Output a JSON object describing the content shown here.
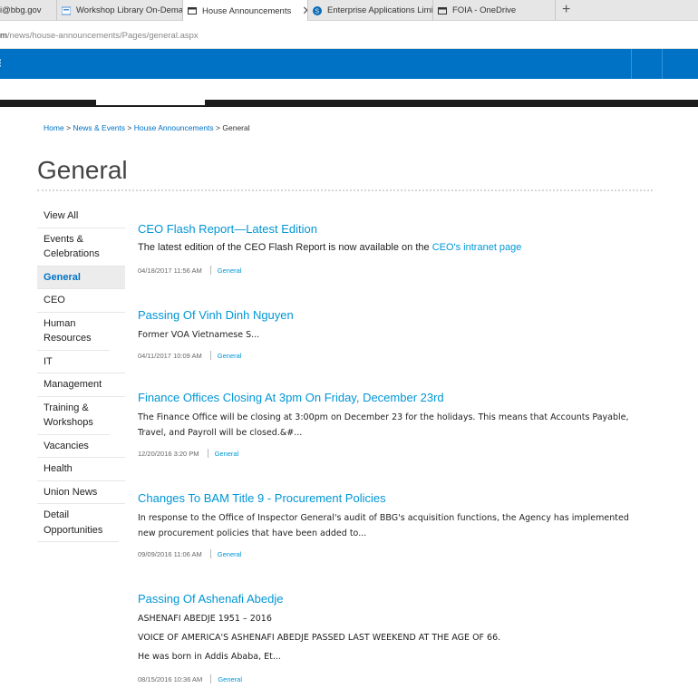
{
  "browser": {
    "tabs": [
      {
        "label": "i@bbg.gov",
        "active": false
      },
      {
        "label": "Workshop Library On-Dema",
        "active": false
      },
      {
        "label": "House Announcements",
        "active": true
      },
      {
        "label": "Enterprise Applications Limi",
        "active": false
      },
      {
        "label": "FOIA - OneDrive",
        "active": false
      }
    ],
    "new_tab_glyph": "+",
    "close_glyph": "✕",
    "url_host": "m",
    "url_path": "/news/house-announcements/Pages/general.aspx"
  },
  "breadcrumb": {
    "items": [
      "Home",
      "News & Events",
      "House Announcements"
    ],
    "separator": ">",
    "current": "General"
  },
  "page": {
    "title": "General"
  },
  "nav": {
    "items": [
      {
        "label": "View All",
        "active": false
      },
      {
        "label": "Events & Celebrations",
        "active": false
      },
      {
        "label": "General",
        "active": true
      },
      {
        "label": "CEO",
        "active": false
      },
      {
        "label": "Human Resources",
        "active": false
      },
      {
        "label": "IT",
        "active": false
      },
      {
        "label": "Management",
        "active": false
      },
      {
        "label": "Training & Workshops",
        "active": false
      },
      {
        "label": "Vacancies",
        "active": false
      },
      {
        "label": "Health",
        "active": false
      },
      {
        "label": "Union News",
        "active": false
      },
      {
        "label": "Detail Opportunities",
        "active": false
      }
    ]
  },
  "posts": [
    {
      "title": "CEO Flash Report—Latest Edition",
      "body_prefix": "The latest edition of the CEO Flash Report is now available on the ",
      "body_link": "CEO's intranet page",
      "date": "04/18/2017 11:56 AM",
      "category": "General"
    },
    {
      "title": "Passing Of Vinh Dinh Nguyen",
      "body": "Former VOA Vietnamese S...",
      "date": "04/11/2017 10:09 AM",
      "category": "General"
    },
    {
      "title": "Finance Offices Closing At 3pm On Friday, December 23rd",
      "body": "The Finance Office will be closing at 3:00pm on December 23 for the holidays.  This means that Accounts Payable, Travel, and Payroll will be closed.&#...",
      "date": "12/20/2016 3:20 PM",
      "category": "General"
    },
    {
      "title": "Changes To BAM Title 9 - Procurement Policies",
      "body": "In response to the Office of Inspector General's audit of BBG's acquisition functions, the Agency has implemented new procurement policies that have been added to...",
      "date": "09/09/2016 11:06 AM",
      "category": "General"
    },
    {
      "title": "Passing Of Ashenafi Abedje",
      "lines": [
        "ASHENAFI ABEDJE 1951 – 2016",
        "VOICE OF AMERICA'S ASHENAFI ABEDJE PASSED LAST WEEKEND AT THE AGE OF 66.",
        "He was born in Addis Ababa, Et..."
      ],
      "date": "08/15/2016 10:36 AM",
      "category": "General"
    }
  ],
  "colors": {
    "brand_blue": "#0072c6",
    "link_blue": "#0096d6"
  }
}
